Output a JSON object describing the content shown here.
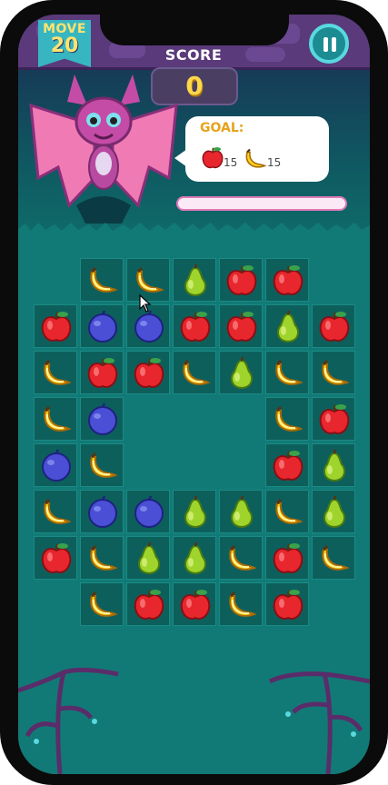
{
  "hud": {
    "move_label": "MOVE",
    "moves": "20",
    "score_label": "SCORE",
    "score": "0",
    "pause_icon": "pause-icon"
  },
  "goal": {
    "label": "GOAL:",
    "items": [
      {
        "fruit": "apple",
        "count": "15"
      },
      {
        "fruit": "banana",
        "count": "15"
      }
    ],
    "progress": 0
  },
  "colors": {
    "apple": "#e8262e",
    "banana": "#ffd21a",
    "pear": "#9ed42c",
    "plum": "#4a4fd6",
    "board": "#127a76",
    "progress_fill": "#ff6fbf"
  },
  "board": {
    "rows": [
      [
        "",
        "banana",
        "banana",
        "pear",
        "apple",
        "apple",
        ""
      ],
      [
        "apple",
        "plum",
        "plum",
        "apple",
        "apple",
        "pear",
        "apple"
      ],
      [
        "banana",
        "apple",
        "apple",
        "banana",
        "pear",
        "banana",
        "banana"
      ],
      [
        "banana",
        "plum",
        "",
        "",
        "",
        "banana",
        "apple"
      ],
      [
        "plum",
        "banana",
        "",
        "",
        "",
        "apple",
        "pear"
      ],
      [
        "banana",
        "plum",
        "plum",
        "pear",
        "pear",
        "banana",
        "pear"
      ],
      [
        "apple",
        "banana",
        "pear",
        "pear",
        "banana",
        "apple",
        "banana"
      ],
      [
        "",
        "banana",
        "apple",
        "apple",
        "banana",
        "apple",
        ""
      ]
    ]
  }
}
